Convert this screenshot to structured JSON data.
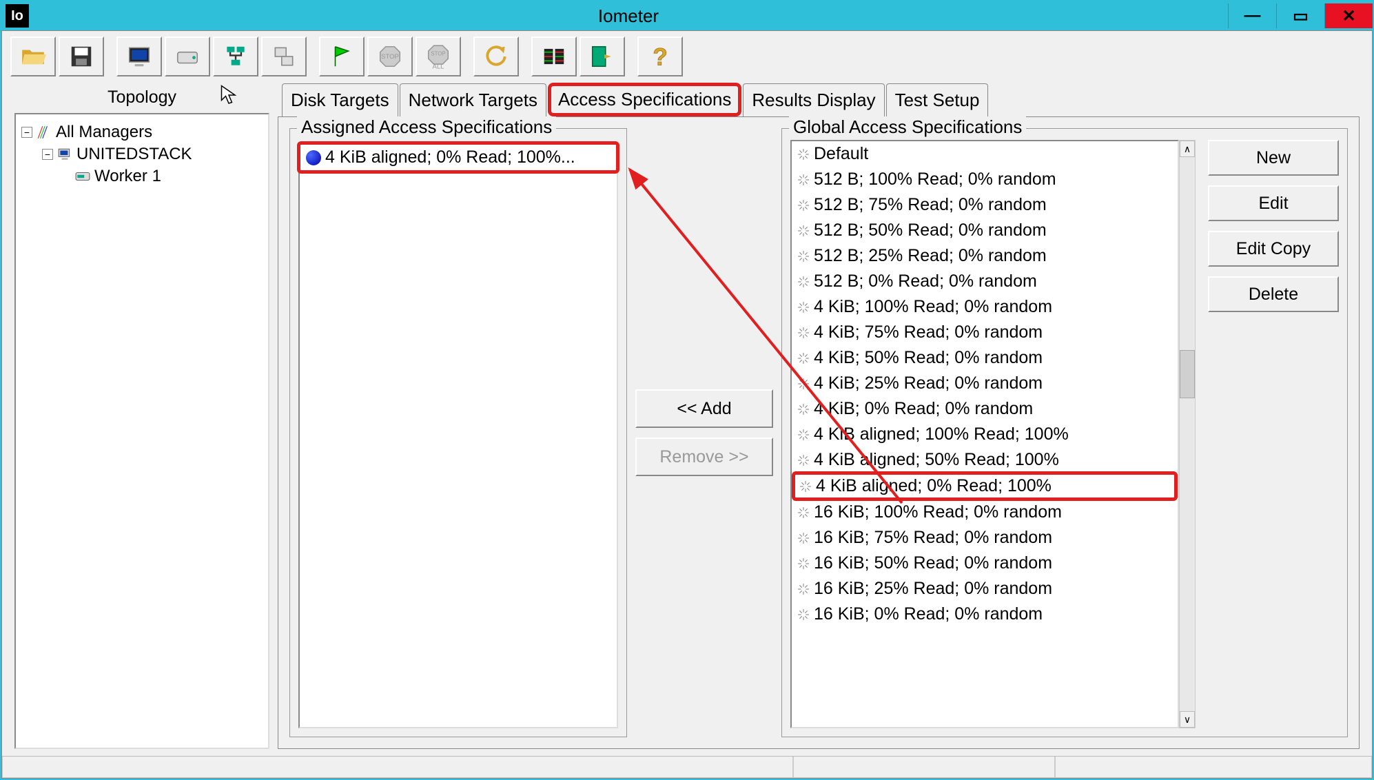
{
  "titlebar": {
    "icon_text": "Io",
    "title": "Iometer",
    "minimize": "—",
    "maximize": "▭",
    "close": "✕"
  },
  "toolbar": {
    "open": "open-icon",
    "save": "save-icon",
    "disk1": "display-icon",
    "disk2": "disk-icon",
    "net": "network-icon",
    "copy": "copy-icon",
    "flag": "flag-icon",
    "stop": "stop-icon",
    "stopall": "stop-all-icon",
    "reset": "reset-icon",
    "results": "results-icon",
    "exit": "exit-icon",
    "help": "help-icon"
  },
  "topology": {
    "title": "Topology",
    "root": "All Managers",
    "manager": "UNITEDSTACK",
    "worker": "Worker 1"
  },
  "tabs": {
    "disk": "Disk Targets",
    "network": "Network Targets",
    "access": "Access Specifications",
    "results": "Results Display",
    "setup": "Test Setup"
  },
  "assigned": {
    "legend": "Assigned Access Specifications",
    "item": "4 KiB aligned; 0% Read; 100%..."
  },
  "middle": {
    "add": "<< Add",
    "remove": "Remove >>"
  },
  "global": {
    "legend": "Global Access Specifications",
    "items": [
      "Default",
      "512 B; 100% Read; 0% random",
      "512 B; 75% Read; 0% random",
      "512 B; 50% Read; 0% random",
      "512 B; 25% Read; 0% random",
      "512 B; 0% Read; 0% random",
      "4 KiB; 100% Read; 0% random",
      "4 KiB; 75% Read; 0% random",
      "4 KiB; 50% Read; 0% random",
      "4 KiB; 25% Read; 0% random",
      "4 KiB; 0% Read; 0% random",
      "4 KiB aligned; 100% Read; 100%",
      "4 KiB aligned; 50% Read; 100%",
      "4 KiB aligned; 0% Read; 100%",
      "16 KiB; 100% Read; 0% random",
      "16 KiB; 75% Read; 0% random",
      "16 KiB; 50% Read; 0% random",
      "16 KiB; 25% Read; 0% random",
      "16 KiB; 0% Read; 0% random"
    ],
    "highlight_index": 13
  },
  "actions": {
    "new": "New",
    "edit": "Edit",
    "editcopy": "Edit Copy",
    "delete": "Delete"
  }
}
